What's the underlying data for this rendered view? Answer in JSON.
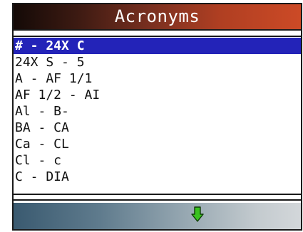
{
  "title": "Acronyms",
  "list": {
    "items": [
      {
        "label": "# - 24X C",
        "selected": true
      },
      {
        "label": "24X S - 5",
        "selected": false
      },
      {
        "label": "A - AF 1/1",
        "selected": false
      },
      {
        "label": "AF 1/2 - AI",
        "selected": false
      },
      {
        "label": "Al - B-",
        "selected": false
      },
      {
        "label": "BA - CA",
        "selected": false
      },
      {
        "label": "Ca - CL",
        "selected": false
      },
      {
        "label": "Cl - c",
        "selected": false
      },
      {
        "label": "C - DIA",
        "selected": false
      }
    ]
  },
  "bottom_bar": {
    "icon": "down-arrow-icon",
    "icon_color": "#39c21f"
  },
  "colors": {
    "title_text": "#ffffff",
    "selection_background": "#2323b8",
    "selection_text": "#ffffff"
  }
}
